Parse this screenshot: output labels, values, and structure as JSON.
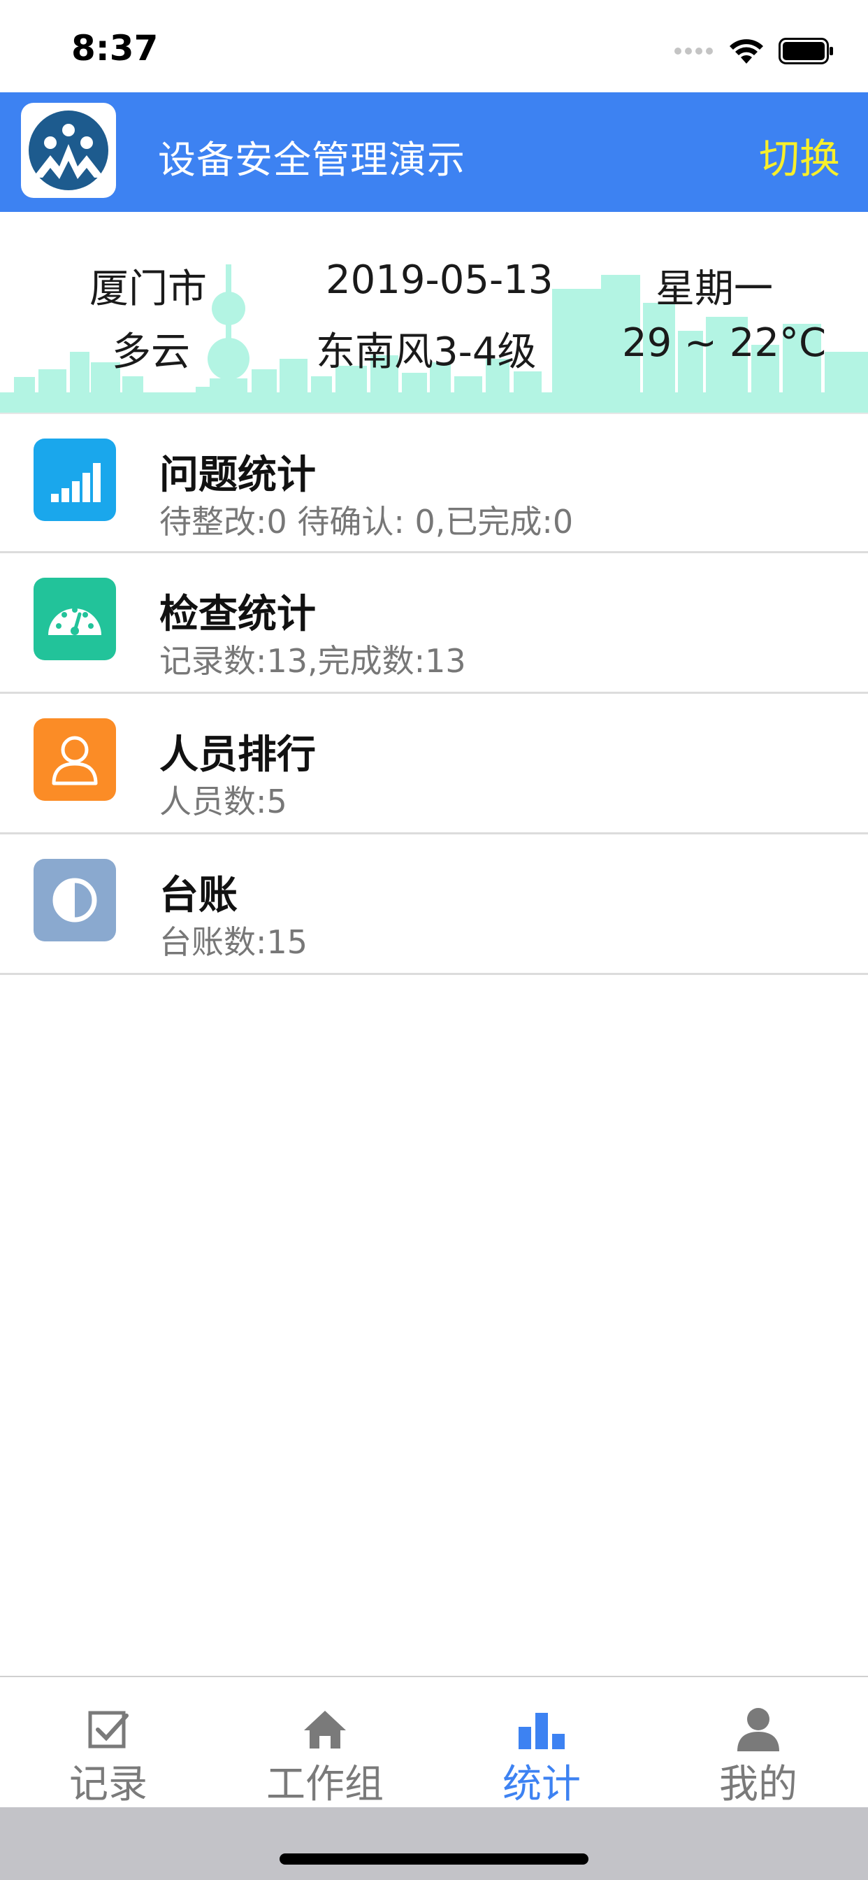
{
  "status_bar": {
    "time": "8:37"
  },
  "header": {
    "title": "设备安全管理演示",
    "switch_label": "切换",
    "logo_icon": "mountain-logo-icon"
  },
  "weather": {
    "city": "厦门市",
    "date": "2019-05-13",
    "weekday": "星期一",
    "condition": "多云",
    "wind": "东南风3-4级",
    "temperature": "29 ~ 22°C"
  },
  "stats": [
    {
      "title": "问题统计",
      "subtitle": "待整改:0 待确认: 0,已完成:0",
      "icon": "signal-bars-icon",
      "color": "#1aa7ec"
    },
    {
      "title": "检查统计",
      "subtitle": "记录数:13,完成数:13",
      "icon": "gauge-icon",
      "color": "#22c39a"
    },
    {
      "title": "人员排行",
      "subtitle": "人员数:5",
      "icon": "person-icon",
      "color": "#fb8c26"
    },
    {
      "title": "台账",
      "subtitle": "台账数:15",
      "icon": "half-circle-icon",
      "color": "#8aa9cf"
    }
  ],
  "tabs": [
    {
      "label": "记录",
      "icon": "checkbox-icon",
      "active": false
    },
    {
      "label": "工作组",
      "icon": "home-icon",
      "active": false
    },
    {
      "label": "统计",
      "icon": "bar-chart-icon",
      "active": true
    },
    {
      "label": "我的",
      "icon": "user-icon",
      "active": false
    }
  ],
  "colors": {
    "header_bg": "#3d82f2",
    "switch_text": "#f7ef2b",
    "skyline": "#b3f4e3",
    "tab_active": "#3d82f2",
    "tab_inactive": "#7a7a7a"
  }
}
